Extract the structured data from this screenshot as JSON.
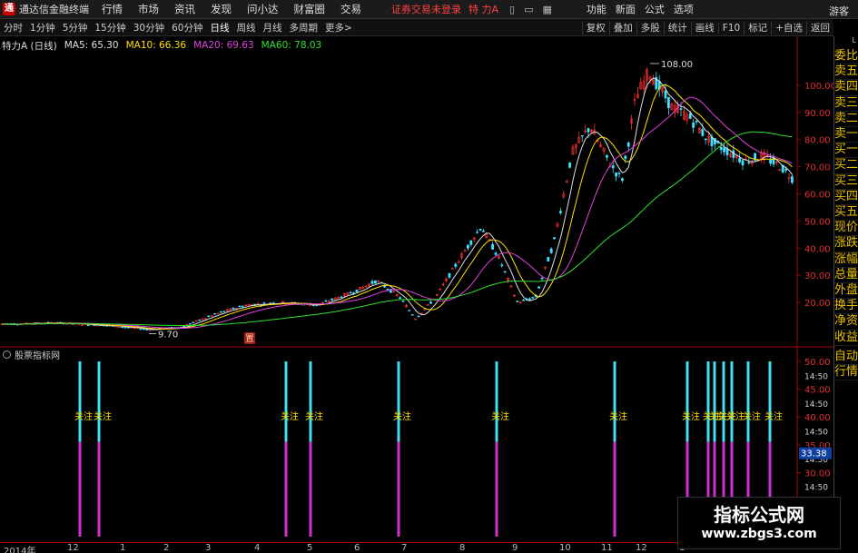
{
  "menubar": {
    "app_title": "通达信金融终端",
    "items": [
      "行情",
      "市场",
      "资讯",
      "发现",
      "问小达",
      "财富圈",
      "交易"
    ],
    "login_status": "证券交易未登录",
    "stock_name": "特 力A",
    "right_items": [
      "功能",
      "新面",
      "公式",
      "选项"
    ],
    "guest": "游客"
  },
  "toolbar": {
    "periods": [
      "分时",
      "1分钟",
      "5分钟",
      "15分钟",
      "30分钟",
      "60分钟",
      "日线",
      "周线",
      "月线",
      "多周期",
      "更多>"
    ],
    "active_period": "日线",
    "tools": [
      "复权",
      "叠加",
      "多股",
      "统计",
      "画线",
      "F10",
      "标记",
      "+自选",
      "返回"
    ]
  },
  "chart": {
    "stock_label": "特力A (日线)",
    "ma5": "MA5: 65.30",
    "ma10": "MA10: 66.36",
    "ma20": "MA20: 69.63",
    "ma60": "MA60: 78.03",
    "high_label": "108.00",
    "low_label": "9.70",
    "marker_label": "置",
    "colors": {
      "up": "#ff3030",
      "down": "#40e0ff",
      "ma5": "#e0e0e0",
      "ma10": "#ffe000",
      "ma20": "#e040e0",
      "ma60": "#30e030"
    }
  },
  "chart_data": [
    {
      "type": "line",
      "title": "特力A (日线)",
      "y_ticks": [
        20.0,
        30.0,
        40.0,
        50.0,
        60.0,
        70.0,
        80.0,
        90.0,
        100.0
      ],
      "ylim": [
        5,
        112
      ],
      "annotations": [
        {
          "text": "108.00",
          "kind": "high"
        },
        {
          "text": "9.70",
          "kind": "low"
        }
      ],
      "series": [
        {
          "name": "MA5",
          "value_label": "65.30"
        },
        {
          "name": "MA10",
          "value_label": "66.36"
        },
        {
          "name": "MA20",
          "value_label": "69.63"
        },
        {
          "name": "MA60",
          "value_label": "78.03"
        }
      ]
    },
    {
      "type": "bar",
      "title": "股票指标网",
      "y_ticks": [
        "50.00",
        "45.00",
        "40.00",
        "35.00",
        "30.00"
      ],
      "x_tick_labels": [
        "14:50",
        "14:50",
        "14:50",
        "14:50",
        "14:50",
        "14:50"
      ],
      "current_value": "33.38",
      "signal_label": "关注",
      "signal_count": 14
    }
  ],
  "indicator": {
    "title": "股票指标网",
    "current_value": "33.38",
    "signal_label": "关注"
  },
  "side_panel": {
    "top": "L",
    "items": [
      "委比",
      "卖五",
      "卖四",
      "卖三",
      "卖二",
      "卖一",
      "买一",
      "买二",
      "买三",
      "买四",
      "买五",
      "现价",
      "涨跌",
      "涨幅",
      "总量",
      "外盘",
      "换手",
      "净资",
      "收益"
    ],
    "items2": [
      "自动",
      "行情"
    ]
  },
  "time_axis": {
    "labels": [
      "2014年",
      "12",
      "1",
      "2",
      "3",
      "4",
      "5",
      "6",
      "7",
      "8",
      "9",
      "10",
      "11",
      "12",
      "1"
    ]
  },
  "watermark": {
    "title": "指标公式网",
    "url": "www.zbgs3.com"
  }
}
